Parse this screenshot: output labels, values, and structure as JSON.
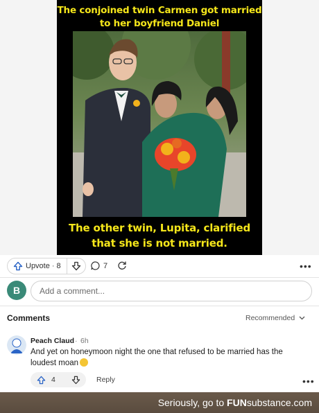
{
  "meme": {
    "caption_top": "The conjoined twin Carmen got married to her boyfriend Daniel",
    "caption_bottom": "The other twin, Lupita, clarified that she is not married."
  },
  "actions": {
    "upvote_label": "Upvote",
    "separator": "·",
    "upvote_count": "8",
    "comment_count": "7",
    "more_icon": "more-horizontal-icon"
  },
  "composer": {
    "avatar_letter": "B",
    "placeholder": "Add a comment..."
  },
  "comments_section": {
    "title": "Comments",
    "sort_label": "Recommended"
  },
  "comment": {
    "author": "Peach Claud",
    "separator": "·",
    "time": "6h",
    "body": "And yet on honeymoon night the one that refused to be married has the loudest moan",
    "emoji": "smirk-emoji",
    "vote_count": "4",
    "reply_label": "Reply"
  },
  "footer": {
    "text": "Seriously, go to",
    "brand_bold": "FUN",
    "brand_rest": "substance",
    "suffix": ".com"
  },
  "colors": {
    "caption": "#f5e61a",
    "avatar_b": "#3a8a78",
    "dress": "#1e6f57",
    "suit": "#2b2f3a",
    "bouquet": "#e8452a"
  }
}
